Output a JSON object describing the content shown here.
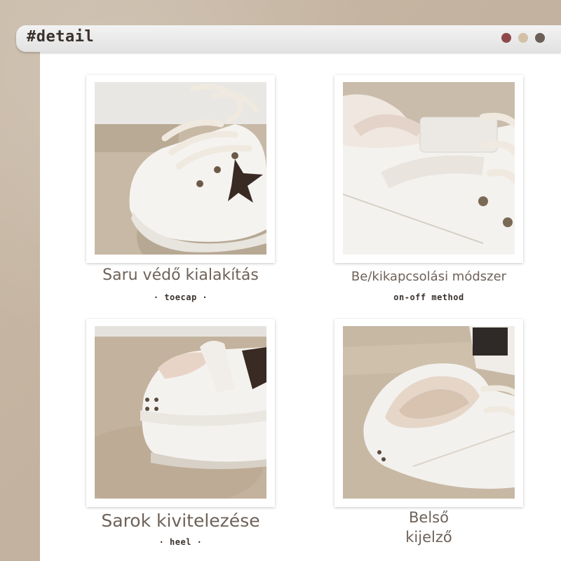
{
  "header": {
    "title": "#detail"
  },
  "colors": {
    "dot1": "#8e4a4a",
    "dot2": "#d2c1a6",
    "dot3": "#6b5f58"
  },
  "panels": [
    {
      "caption": "Saru védő kialakítás",
      "sub": "· toecap ·",
      "image": "sneaker toecap close-up photo"
    },
    {
      "caption": "Be/kikapcsolási módszer",
      "sub": "on-off method",
      "image": "sneaker velcro strap close-up photo"
    },
    {
      "caption": "Sarok kivitelezése",
      "sub": "· heel ·",
      "image": "sneaker heel close-up photo"
    },
    {
      "caption_line1": "Belső",
      "caption_line2": "kijelző",
      "image": "sneaker fleece lining close-up photo"
    }
  ]
}
